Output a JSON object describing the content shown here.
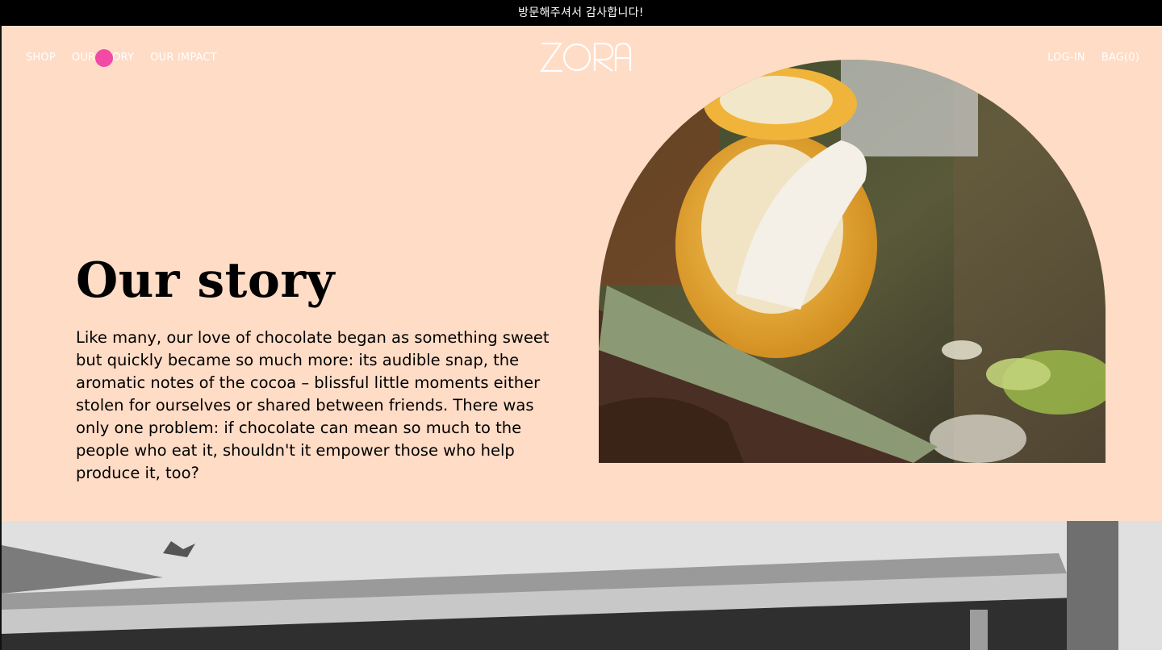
{
  "announcement": {
    "text": "방문해주셔서 감사합니다!"
  },
  "nav": {
    "left": [
      "SHOP",
      "OUR STORY",
      "OUR IMPACT"
    ],
    "right": [
      "LOG-IN",
      "BAG(0)"
    ]
  },
  "logo": {
    "text": "ZORA"
  },
  "hero": {
    "title": "Our story",
    "body": "Like many, our love of chocolate began as something sweet but quickly became so much more: its audible snap, the aromatic notes of the cocoa – blissful little moments either stolen for ourselves or shared between friends. There was only one problem: if chocolate can mean so much to the people who eat it, shouldn't it empower those who help produce it, too?"
  },
  "images": {
    "hero_photo": "cocoa-pod-photo",
    "bottom_photo": "village-roof-photo"
  },
  "colors": {
    "hero_background": "#ffdcc6",
    "announcement_background": "#000000",
    "cursor_dot": "#f24aa6"
  }
}
